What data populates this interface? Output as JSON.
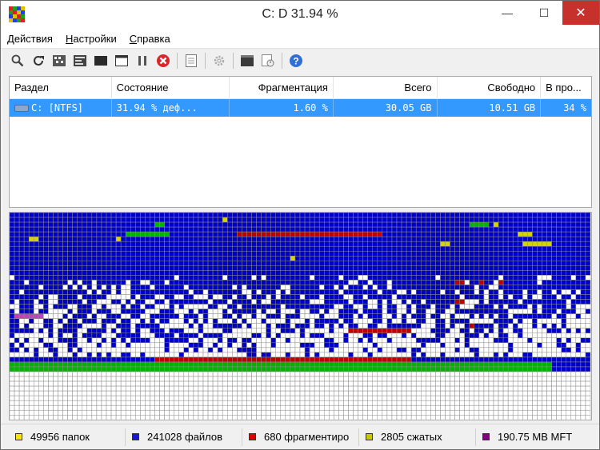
{
  "window": {
    "title": "C:  D  31.94 %"
  },
  "window_controls": {
    "minimize": "—",
    "maximize": "☐",
    "close": "✕"
  },
  "menu": [
    {
      "label": "Действия",
      "underline_first": true
    },
    {
      "label": "Настройки",
      "underline_first": true
    },
    {
      "label": "Справка",
      "underline_first": true
    }
  ],
  "toolbar": [
    {
      "icon": "magnifier-icon"
    },
    {
      "icon": "refresh-icon"
    },
    {
      "icon": "defrag-pattern-icon"
    },
    {
      "icon": "map-pattern-icon"
    },
    {
      "icon": "dark-block-icon"
    },
    {
      "icon": "window-icon"
    },
    {
      "icon": "pause-icon"
    },
    {
      "icon": "stop-icon"
    },
    {
      "icon": "report-icon"
    },
    {
      "icon": "gear-icon"
    },
    {
      "icon": "console-icon"
    },
    {
      "icon": "scheduler-icon"
    },
    {
      "icon": "help-icon"
    }
  ],
  "volume_list": {
    "headers": [
      "Раздел",
      "Состояние",
      "Фрагментация",
      "Всего",
      "Свободно",
      "В про..."
    ],
    "rows": [
      [
        "C: [NTFS]",
        "31.94 % деф...",
        "1.60 %",
        "30.05 GB",
        "10.51 GB",
        "34 %"
      ]
    ]
  },
  "status_bar": [
    {
      "label": "49956 папок",
      "color": "#f4e600"
    },
    {
      "label": "241028 файлов",
      "color": "#1919d2"
    },
    {
      "label": "680 фрагментиро",
      "color": "#e00000"
    },
    {
      "label": "2805 сжатых",
      "color": "#c8c800"
    },
    {
      "label": "190.75 MB MFT",
      "color": "#800080"
    }
  ],
  "cluster_colors": {
    "free": "#ffffff",
    "file": "#0000c8",
    "fragmented": "#c00000",
    "system": "#00b400",
    "compressed": "#d4d400",
    "mft": "#c040c0",
    "grid": "#8c8c8c"
  }
}
